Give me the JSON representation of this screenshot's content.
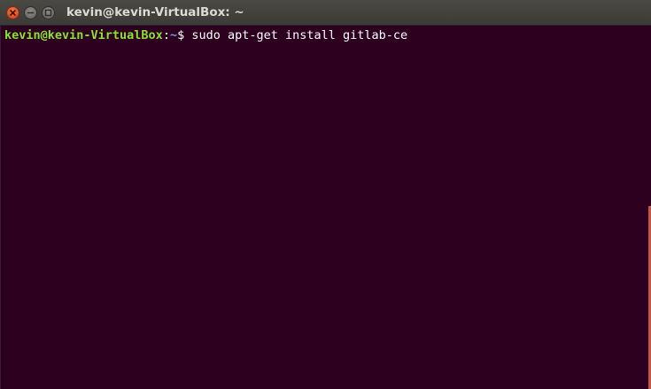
{
  "window": {
    "title": "kevin@kevin-VirtualBox: ~"
  },
  "terminal": {
    "user_host": "kevin@kevin-VirtualBox",
    "separator": ":",
    "cwd": "~",
    "prompt_symbol": "$ ",
    "command": "sudo apt-get install gitlab-ce"
  },
  "icons": {
    "close": "close-icon",
    "minimize": "minimize-icon",
    "maximize": "maximize-icon"
  },
  "colors": {
    "background": "#2c001e",
    "user_host": "#8ae234",
    "path": "#729fcf",
    "close_button": "#e0532a",
    "titlebar": "#3c3b37"
  }
}
